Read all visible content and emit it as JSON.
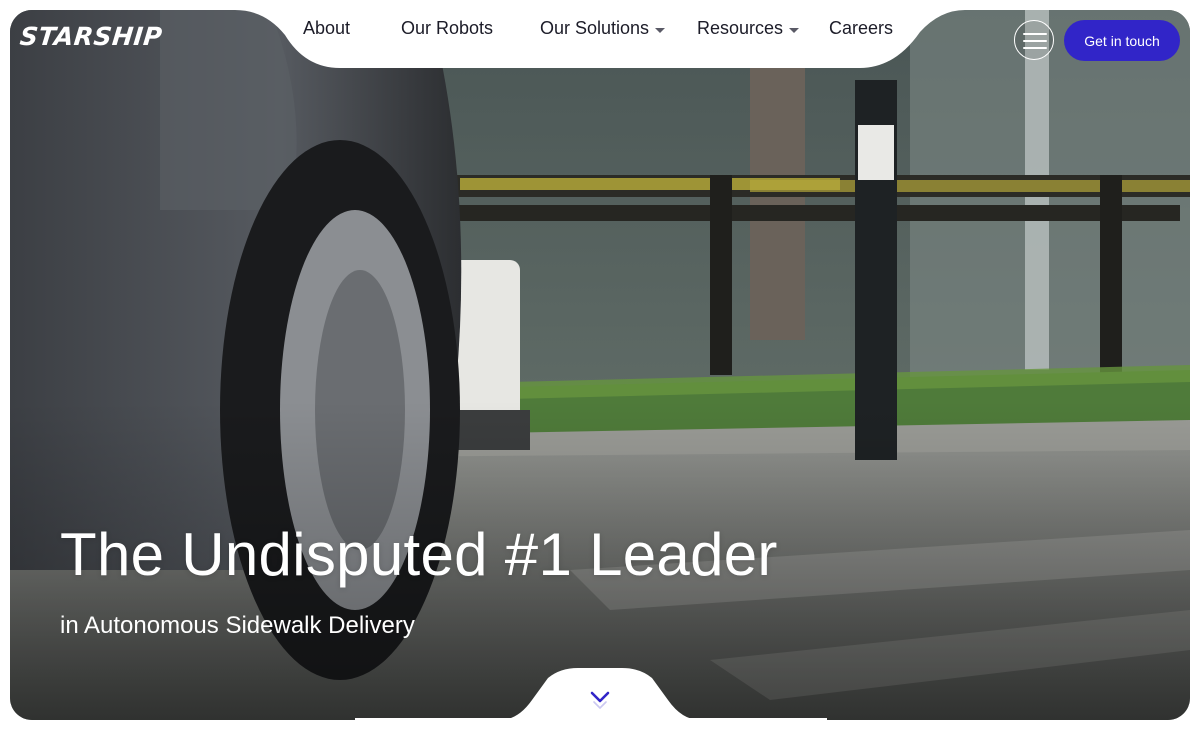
{
  "brand": {
    "logo_text": "STARSHIP"
  },
  "nav": {
    "items": [
      {
        "label": "About",
        "has_dropdown": false
      },
      {
        "label": "Our Robots",
        "has_dropdown": false
      },
      {
        "label": "Our Solutions",
        "has_dropdown": true
      },
      {
        "label": "Resources",
        "has_dropdown": true
      },
      {
        "label": "Careers",
        "has_dropdown": false
      }
    ],
    "menu_icon": "hamburger-menu-icon",
    "cta_label": "Get in touch"
  },
  "hero": {
    "headline": "The Undisputed #1 Leader",
    "subheadline": "in Autonomous Sidewalk Delivery",
    "scroll_icon": "chevron-down-icon"
  },
  "colors": {
    "accent": "#3125c8",
    "nav_text": "#1c1c28",
    "hero_text": "#ffffff"
  }
}
